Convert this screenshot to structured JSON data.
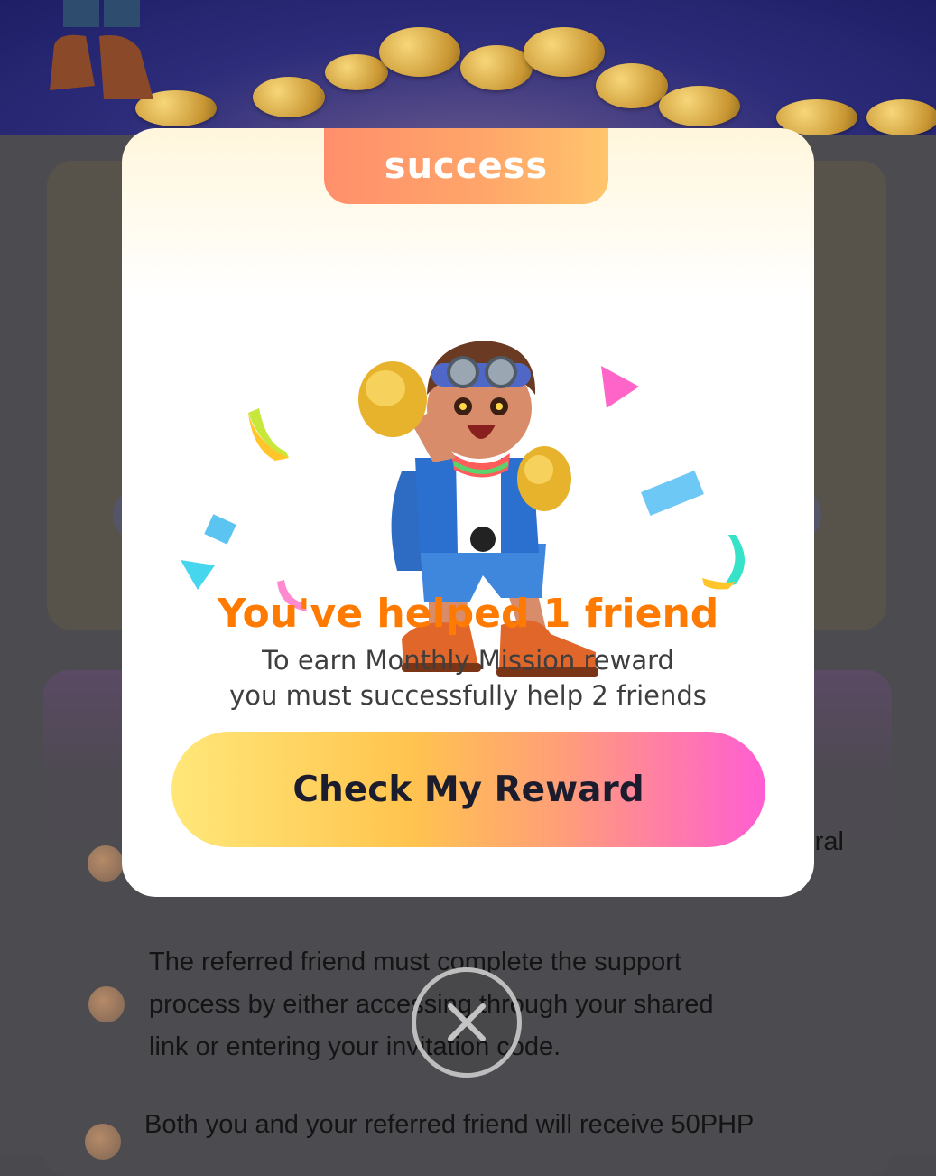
{
  "modal": {
    "tab_label": "success",
    "title": "You've helped 1 friend",
    "desc_line1": "To earn Monthly Mission reward",
    "desc_line2": "you must successfully help 2 friends",
    "button_label": "Check My Reward",
    "illustration": "celebrating-explorer-mascot-with-confetti"
  },
  "background": {
    "rules": [
      {
        "icon": "mascot-icon",
        "text_fragment": "rral"
      },
      {
        "icon": "mascot-icon",
        "lines": [
          "The referred friend must complete the support",
          "process by either accessing through your shared",
          "link or entering your invitation code."
        ]
      },
      {
        "icon": "mascot-icon",
        "lines": [
          "Both you and your referred friend will receive 50PHP"
        ]
      }
    ]
  },
  "close": {
    "icon": "close-icon"
  },
  "colors": {
    "title": "#ff7a00",
    "tab_gradient": [
      "#ff8f6b",
      "#ffc56c"
    ],
    "button_gradient": [
      "#ffe779",
      "#ff5ed2"
    ]
  }
}
